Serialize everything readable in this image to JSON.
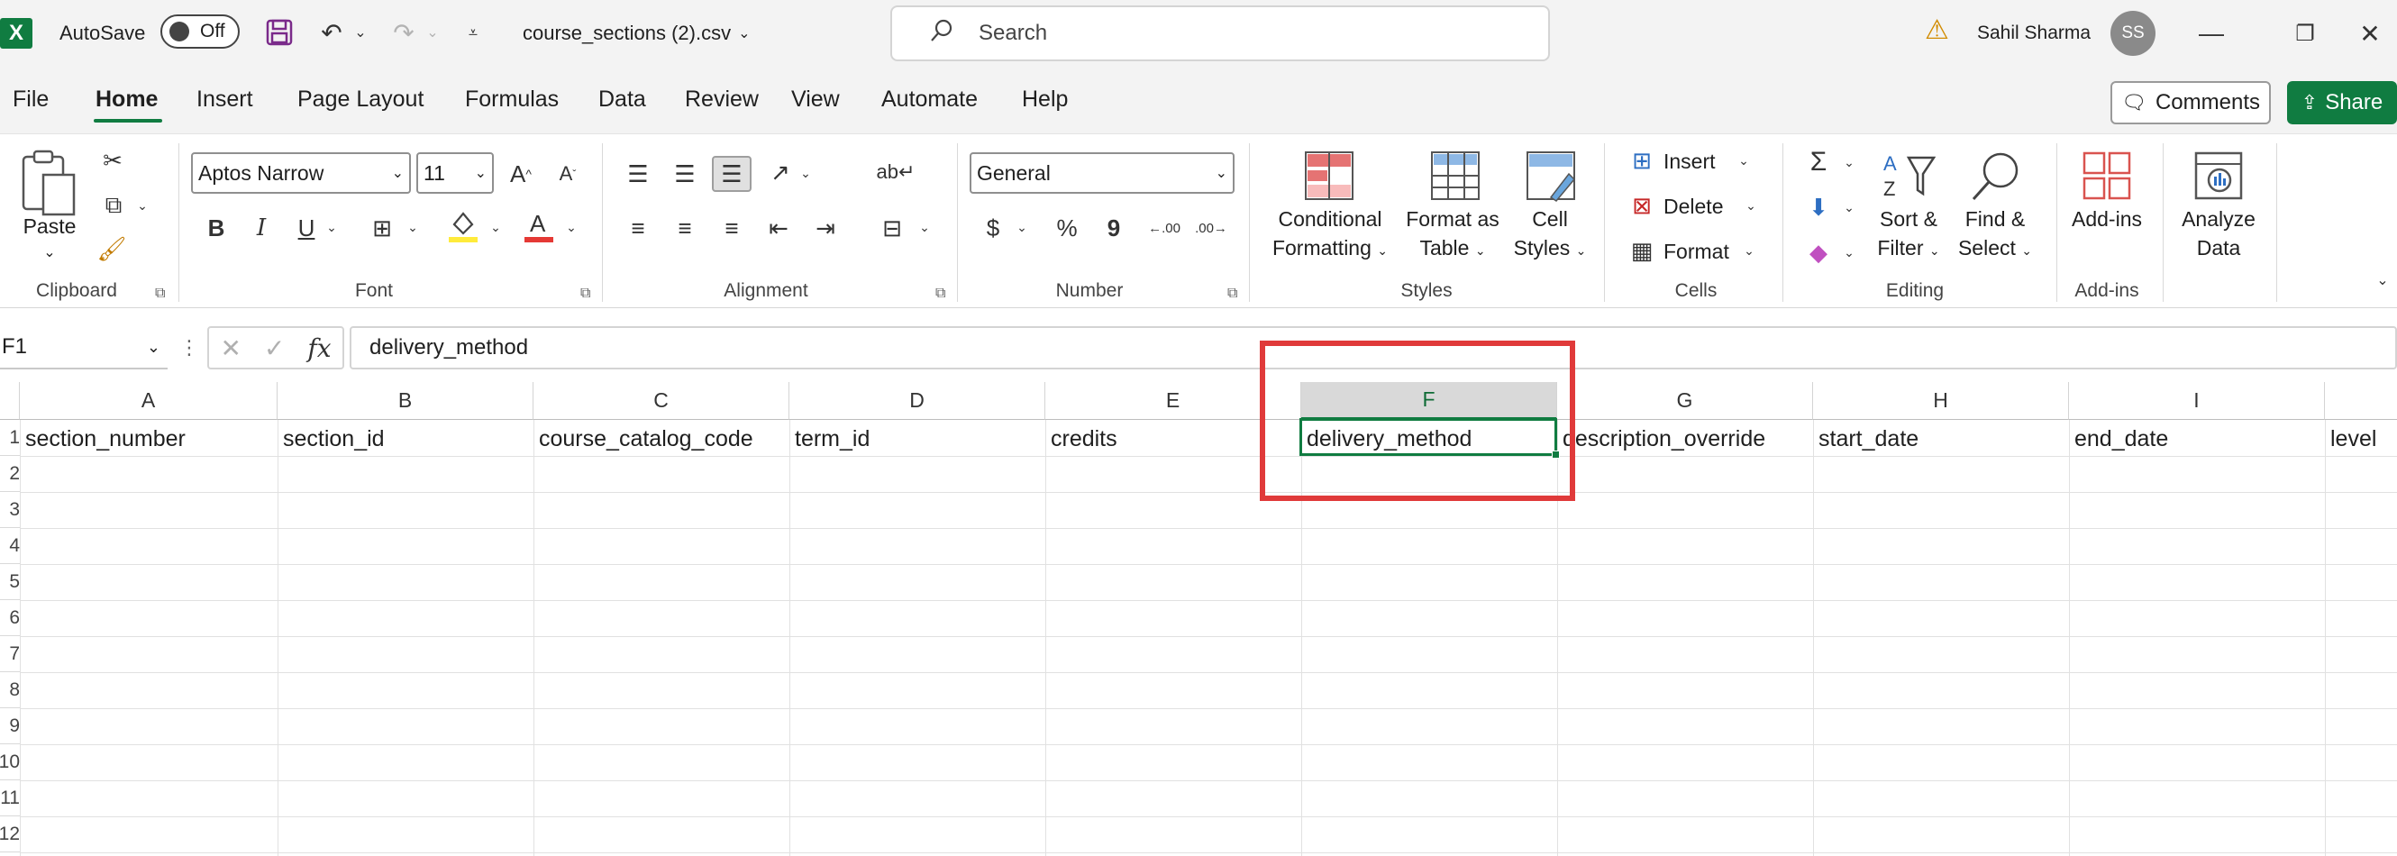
{
  "titlebar": {
    "app_logo": "X",
    "autosave_label": "AutoSave",
    "autosave_state": "Off",
    "filename": "course_sections (2).csv",
    "search_placeholder": "Search",
    "user_name": "Sahil Sharma",
    "user_initials": "SS"
  },
  "menu": {
    "items": [
      "File",
      "Home",
      "Insert",
      "Page Layout",
      "Formulas",
      "Data",
      "Review",
      "View",
      "Automate",
      "Help"
    ],
    "active": "Home",
    "comments_label": "Comments",
    "share_label": "Share"
  },
  "ribbon": {
    "clipboard": {
      "label": "Clipboard",
      "paste": "Paste"
    },
    "font": {
      "label": "Font",
      "font_name": "Aptos Narrow",
      "font_size": "11",
      "bold": "B",
      "italic": "I",
      "underline": "U"
    },
    "alignment": {
      "label": "Alignment"
    },
    "number": {
      "label": "Number",
      "format": "General",
      "currency": "$",
      "percent": "%",
      "comma": "9"
    },
    "styles": {
      "label": "Styles",
      "conditional_line1": "Conditional",
      "conditional_line2": "Formatting",
      "format_table_line1": "Format as",
      "format_table_line2": "Table",
      "cell_styles_line1": "Cell",
      "cell_styles_line2": "Styles"
    },
    "cells": {
      "label": "Cells",
      "insert": "Insert",
      "delete": "Delete",
      "format": "Format"
    },
    "editing": {
      "label": "Editing",
      "sort_line1": "Sort &",
      "sort_line2": "Filter",
      "find_line1": "Find &",
      "find_line2": "Select"
    },
    "addins": {
      "label": "Add-ins",
      "addins_btn": "Add-ins",
      "analyze_line1": "Analyze",
      "analyze_line2": "Data"
    }
  },
  "formula_bar": {
    "name_box": "F1",
    "fx": "fx",
    "content": "delivery_method"
  },
  "sheet": {
    "columns": [
      "A",
      "B",
      "C",
      "D",
      "E",
      "F",
      "G",
      "H",
      "I"
    ],
    "row_numbers": [
      "1",
      "2",
      "3",
      "4",
      "5",
      "6",
      "7",
      "8",
      "9",
      "10",
      "11",
      "12"
    ],
    "row1": [
      "section_number",
      "section_id",
      "course_catalog_code",
      "term_id",
      "credits",
      "delivery_method",
      "description_override",
      "start_date",
      "end_date",
      "level"
    ],
    "selected_column": "F",
    "active_cell": "F1"
  },
  "colors": {
    "brand_green": "#107c41",
    "highlight_red": "#e03a3a"
  }
}
